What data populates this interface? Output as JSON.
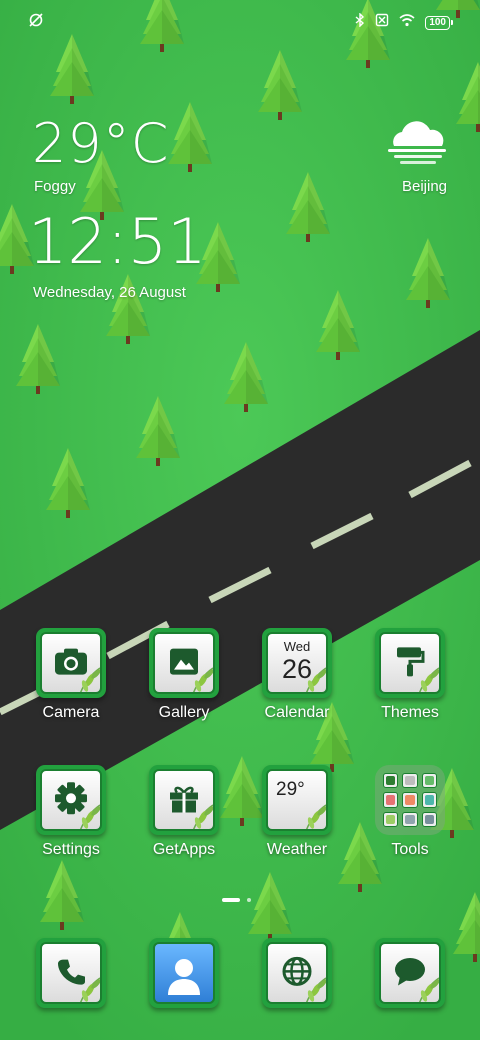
{
  "status_bar": {
    "left_icon": "no-sync-icon",
    "right_icons": [
      "bluetooth-icon",
      "no-sim-icon",
      "wifi-icon"
    ],
    "battery": "100"
  },
  "weather_widget": {
    "temperature": "29°C",
    "condition": "Foggy",
    "city": "Beijing",
    "icon": "fog-cloud-icon"
  },
  "clock_widget": {
    "time": "12:51",
    "date": "Wednesday, 26 August"
  },
  "apps_row1": [
    {
      "label": "Camera",
      "icon": "camera-icon"
    },
    {
      "label": "Gallery",
      "icon": "gallery-icon"
    },
    {
      "label": "Calendar",
      "icon": "calendar-icon",
      "day": "Wed",
      "date": "26"
    },
    {
      "label": "Themes",
      "icon": "paint-roller-icon"
    }
  ],
  "apps_row2": [
    {
      "label": "Settings",
      "icon": "gear-icon"
    },
    {
      "label": "GetApps",
      "icon": "gift-icon"
    },
    {
      "label": "Weather",
      "icon": "weather-icon",
      "temp": "29°"
    },
    {
      "label": "Tools",
      "icon": "folder-icon"
    }
  ],
  "dock": [
    {
      "icon": "phone-icon"
    },
    {
      "icon": "contacts-icon"
    },
    {
      "icon": "browser-icon"
    },
    {
      "icon": "messages-icon"
    }
  ],
  "page_indicator": {
    "pages": 2,
    "current": 1
  },
  "colors": {
    "grass": "#3cb648",
    "road": "#2b2b2b",
    "tile_border": "#22a13e",
    "glyph": "#1d5a2d"
  }
}
